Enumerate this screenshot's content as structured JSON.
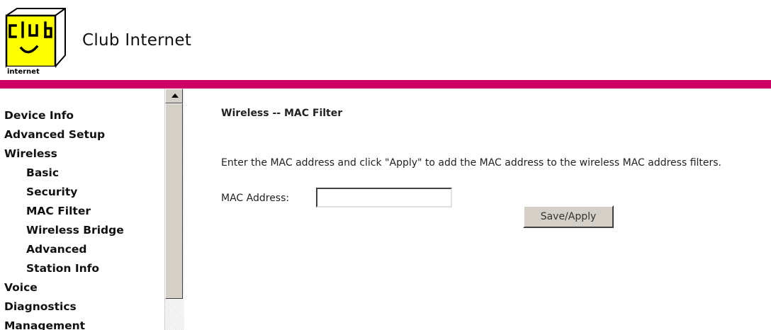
{
  "header": {
    "logo_top_text": "club",
    "logo_bottom_text": "internet",
    "brand": "Club Internet",
    "bar_color": "#cc0066",
    "logo_color": "#ffff00"
  },
  "sidebar": {
    "items": [
      {
        "label": "Device Info",
        "level": 0
      },
      {
        "label": "Advanced Setup",
        "level": 0
      },
      {
        "label": "Wireless",
        "level": 0
      },
      {
        "label": "Basic",
        "level": 1
      },
      {
        "label": "Security",
        "level": 1
      },
      {
        "label": "MAC Filter",
        "level": 1
      },
      {
        "label": "Wireless Bridge",
        "level": 1
      },
      {
        "label": "Advanced",
        "level": 1
      },
      {
        "label": "Station Info",
        "level": 1
      },
      {
        "label": "Voice",
        "level": 0
      },
      {
        "label": "Diagnostics",
        "level": 0
      },
      {
        "label": "Management",
        "level": 0
      }
    ]
  },
  "main": {
    "title": "Wireless -- MAC Filter",
    "description": "Enter the MAC address and click \"Apply\" to add the MAC address to the wireless MAC address filters.",
    "mac_label": "MAC Address:",
    "mac_value": "",
    "save_label": "Save/Apply"
  }
}
